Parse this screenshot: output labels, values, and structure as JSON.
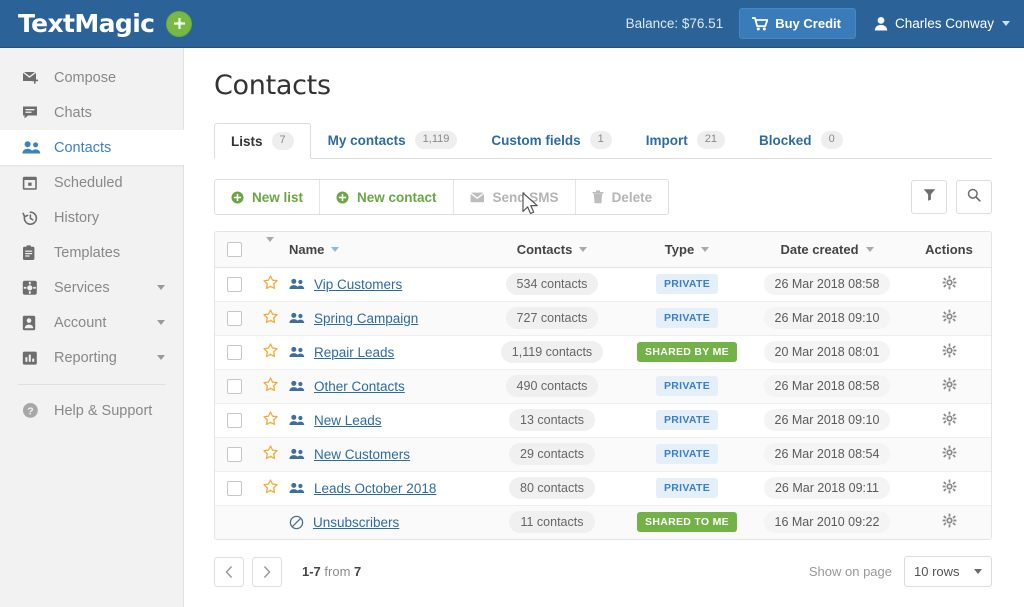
{
  "topbar": {
    "logo_text": "TextMagic",
    "plus_label": "+",
    "plus_icon": "plus-icon",
    "balance_label": "Balance: $76.51",
    "buy_credit_label": "Buy Credit",
    "cart_icon": "shopping-cart-icon",
    "user_name": "Charles Conway",
    "user_icon": "user-icon",
    "caret_icon": "chevron-down-icon",
    "bg_color": "#2b6298",
    "accent_green": "#78b944"
  },
  "sidebar": {
    "items": [
      {
        "label": "Compose",
        "icon": "compose-mail-icon",
        "active": false,
        "has_caret": false
      },
      {
        "label": "Chats",
        "icon": "chat-bubble-icon",
        "active": false,
        "has_caret": false
      },
      {
        "label": "Contacts",
        "icon": "contacts-people-icon",
        "active": true,
        "has_caret": false
      },
      {
        "label": "Scheduled",
        "icon": "calendar-icon",
        "active": false,
        "has_caret": false
      },
      {
        "label": "History",
        "icon": "clock-history-icon",
        "active": false,
        "has_caret": false
      },
      {
        "label": "Templates",
        "icon": "clipboard-icon",
        "active": false,
        "has_caret": false
      },
      {
        "label": "Services",
        "icon": "gear-box-icon",
        "active": false,
        "has_caret": true
      },
      {
        "label": "Account",
        "icon": "user-card-icon",
        "active": false,
        "has_caret": true
      },
      {
        "label": "Reporting",
        "icon": "bar-chart-icon",
        "active": false,
        "has_caret": true
      }
    ],
    "help_item": {
      "label": "Help & Support",
      "icon": "question-circle-icon"
    },
    "active_color": "#3a82c4"
  },
  "main": {
    "page_title": "Contacts",
    "tabs": [
      {
        "label": "Lists",
        "count": "7",
        "active": true
      },
      {
        "label": "My contacts",
        "count": "1,119",
        "active": false
      },
      {
        "label": "Custom fields",
        "count": "1",
        "active": false
      },
      {
        "label": "Import",
        "count": "21",
        "active": false
      },
      {
        "label": "Blocked",
        "count": "0",
        "active": false
      }
    ],
    "toolbar": {
      "new_list_label": "New list",
      "new_list_icon": "plus-circle-icon",
      "new_contact_label": "New contact",
      "new_contact_icon": "plus-circle-icon",
      "send_sms_label": "Send SMS",
      "send_sms_icon": "envelope-icon",
      "delete_label": "Delete",
      "delete_icon": "trash-icon",
      "filter_icon": "filter-funnel-icon",
      "search_icon": "search-icon"
    },
    "table": {
      "headers": {
        "select_all": "select-all-checkbox",
        "bulk_caret": "chevron-down-icon",
        "name": "Name",
        "contacts": "Contacts",
        "type": "Type",
        "date_created": "Date created",
        "actions": "Actions"
      },
      "rows": [
        {
          "name": "Vip Customers",
          "icon": "people-icon",
          "contacts": "534 contacts",
          "type": "PRIVATE",
          "type_style": "private",
          "date": "26 Mar 2018 08:58",
          "has_checkbox": true,
          "has_star": true
        },
        {
          "name": "Spring Campaign",
          "icon": "people-icon",
          "contacts": "727 contacts",
          "type": "PRIVATE",
          "type_style": "private",
          "date": "26 Mar 2018 09:10",
          "has_checkbox": true,
          "has_star": true
        },
        {
          "name": "Repair Leads",
          "icon": "people-icon",
          "contacts": "1,119 contacts",
          "type": "SHARED BY ME",
          "type_style": "shared",
          "date": "20 Mar 2018 08:01",
          "has_checkbox": true,
          "has_star": true
        },
        {
          "name": "Other Contacts",
          "icon": "people-icon",
          "contacts": "490 contacts",
          "type": "PRIVATE",
          "type_style": "private",
          "date": "26 Mar 2018 08:58",
          "has_checkbox": true,
          "has_star": true
        },
        {
          "name": "New Leads",
          "icon": "people-icon",
          "contacts": "13 contacts",
          "type": "PRIVATE",
          "type_style": "private",
          "date": "26 Mar 2018 09:10",
          "has_checkbox": true,
          "has_star": true
        },
        {
          "name": "New Customers",
          "icon": "people-icon",
          "contacts": "29 contacts",
          "type": "PRIVATE",
          "type_style": "private",
          "date": "26 Mar 2018 08:54",
          "has_checkbox": true,
          "has_star": true
        },
        {
          "name": "Leads October 2018",
          "icon": "people-icon",
          "contacts": "80 contacts",
          "type": "PRIVATE",
          "type_style": "private",
          "date": "26 Mar 2018 09:11",
          "has_checkbox": true,
          "has_star": true
        },
        {
          "name": "Unsubscribers",
          "icon": "prohibited-icon",
          "contacts": "11 contacts",
          "type": "SHARED TO ME",
          "type_style": "shared",
          "date": "16 Mar 2010 09:22",
          "has_checkbox": false,
          "has_star": false
        }
      ],
      "row_action_icon": "gear-icon",
      "star_icon": "star-icon"
    },
    "footer": {
      "prev_icon": "chevron-left-icon",
      "next_icon": "chevron-right-icon",
      "range_text": "1-7",
      "from_text": "from",
      "total_text": "7",
      "show_on_page_label": "Show on page",
      "rows_value": "10 rows",
      "rows_caret": "chevron-down-icon"
    }
  },
  "colors": {
    "brand_blue": "#2b6298",
    "link_blue": "#2c6ca3",
    "green": "#72b246",
    "private_badge_bg": "#e4eff9",
    "private_badge_fg": "#3b7fc4"
  }
}
